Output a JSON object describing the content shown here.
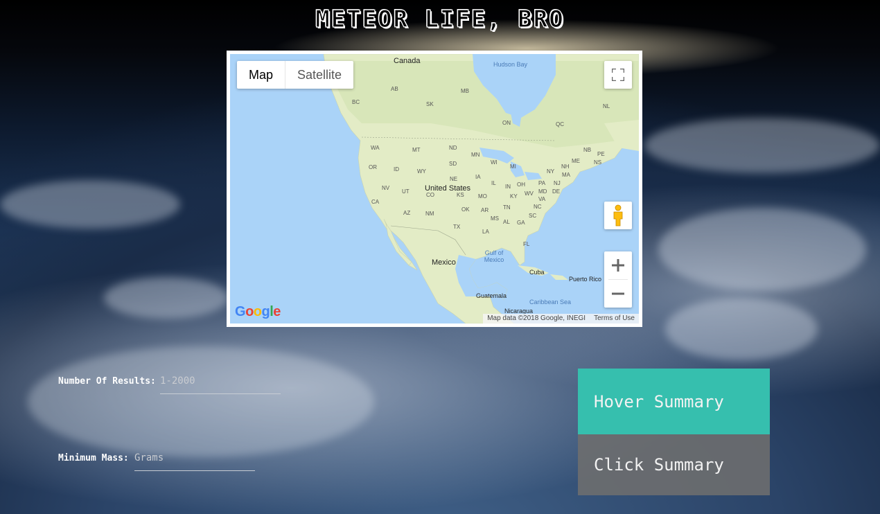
{
  "app": {
    "title": "METEOR LIFE, BRO"
  },
  "map": {
    "type_buttons": {
      "map": "Map",
      "satellite": "Satellite"
    },
    "labels": {
      "canada": "Canada",
      "hudson_bay": "Hudson Bay",
      "ab": "AB",
      "mb": "MB",
      "bc": "BC",
      "sk": "SK",
      "nl": "NL",
      "on": "ON",
      "qc": "QC",
      "wa": "WA",
      "mt": "MT",
      "nd": "ND",
      "mn": "MN",
      "nb": "NB",
      "pe": "PE",
      "ns": "NS",
      "me": "ME",
      "or": "OR",
      "id": "ID",
      "sd": "SD",
      "wi": "WI",
      "mi": "MI",
      "ny": "NY",
      "nh": "NH",
      "ma": "MA",
      "wy": "WY",
      "ne": "NE",
      "ia": "IA",
      "pa": "PA",
      "nj": "NJ",
      "nv": "NV",
      "ut": "UT",
      "co": "CO",
      "united_states": "United States",
      "il": "IL",
      "in": "IN",
      "oh": "OH",
      "md": "MD",
      "de": "DE",
      "ca": "CA",
      "ks": "KS",
      "mo": "MO",
      "ky": "KY",
      "wv": "WV",
      "va": "VA",
      "ok": "OK",
      "ar": "AR",
      "tn": "TN",
      "nc": "NC",
      "az": "AZ",
      "nm": "NM",
      "sc": "SC",
      "tx": "TX",
      "ms": "MS",
      "al": "AL",
      "ga": "GA",
      "la": "LA",
      "fl": "FL",
      "mexico": "Mexico",
      "gulf_of_mexico": "Gulf of Mexico",
      "cuba": "Cuba",
      "puerto_rico": "Puerto Rico",
      "guatemala": "Guatemala",
      "caribbean_sea": "Caribbean Sea",
      "nicaragua": "Nicaragua"
    },
    "google_logo": "Google",
    "attribution": {
      "data": "Map data ©2018 Google, INEGI",
      "terms": "Terms of Use"
    },
    "icons": {
      "fullscreen": "fullscreen-icon",
      "pegman": "pegman-icon",
      "zoom_in": "plus-icon",
      "zoom_out": "minus-icon"
    }
  },
  "form": {
    "results": {
      "label": "Number Of Results:",
      "placeholder": "1-2000",
      "value": ""
    },
    "mass": {
      "label": "Minimum Mass:",
      "placeholder": "Grams",
      "value": ""
    }
  },
  "buttons": {
    "hover_summary": "Hover Summary",
    "click_summary": "Click Summary"
  },
  "colors": {
    "hover_button": "#36bfae",
    "click_button": "#6e6e6e",
    "map_water": "#aad3f8",
    "map_land": "#e8f0cf"
  }
}
